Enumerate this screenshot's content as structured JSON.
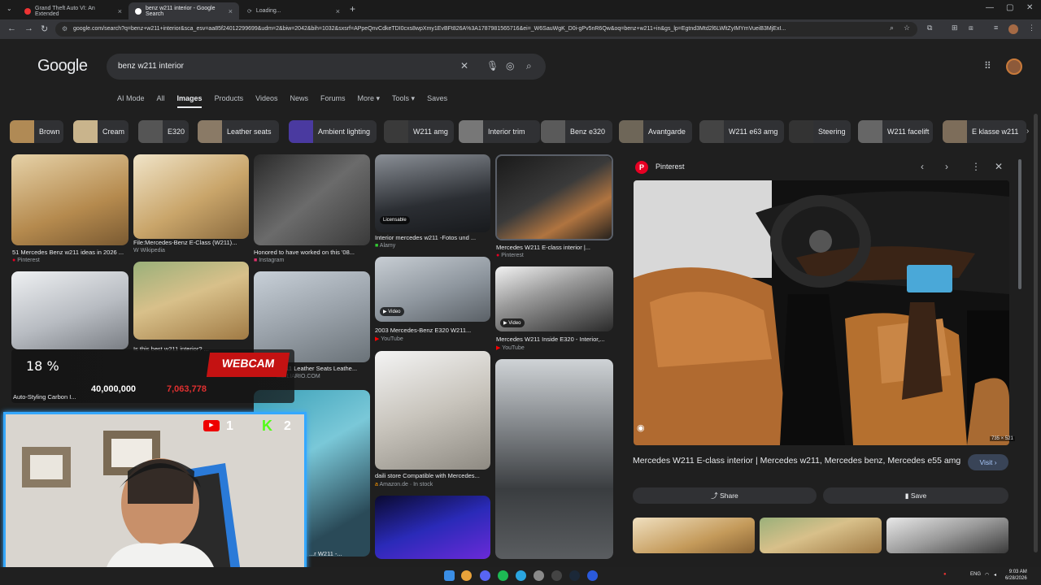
{
  "tabs": [
    {
      "label": "Grand Theft Auto VI: An Extended",
      "active": false
    },
    {
      "label": "benz w211 interior - Google Search",
      "active": true
    },
    {
      "label": "Loading...",
      "active": false
    }
  ],
  "url": "google.com/search?q=benz+w211+interior&sca_esv=aa85f24012299699&udm=2&biw=2042&bih=1032&sxsrf=APpeQnvCdkeTDI0cxs8wpXmy1EvBFt826A%3A1787981565716&ei=_W6SauWgK_D0i-gPv5nR6Qw&oq=benz+w211+in&gs_lp=Egtnd3Mtd2l6LWltZyIMYmVueiB3MjExI...",
  "google": {
    "logo": "Google",
    "query": "benz w211 interior"
  },
  "nav_tabs": [
    "AI Mode",
    "All",
    "Images",
    "Products",
    "Videos",
    "News",
    "Forums",
    "More ▾",
    "Tools ▾",
    "Saves"
  ],
  "chips": [
    "Brown",
    "Cream",
    "E320",
    "Leather seats",
    "Ambient lighting",
    "W211 amg",
    "Interior trim",
    "Benz e320",
    "Avantgarde",
    "W211 e63 amg",
    "Steering",
    "W211 facelift",
    "E klasse w211"
  ],
  "results": [
    {
      "title": "51 Mercedes Benz w211 ideas in 2026 ...",
      "source": "Pinterest"
    },
    {
      "title": "File:Mercedes-Benz E-Class (W211)...",
      "source": "Wikipedia"
    },
    {
      "title": "Honored to have worked on this '08...",
      "source": "Instagram"
    },
    {
      "title": "Interior mercedes w211 -Fotos und ...",
      "source": "Alamy",
      "badge": "Licensable"
    },
    {
      "title": "Mercedes W211 E-class interior |...",
      "source": "Pinterest"
    },
    {
      "title": "Is this best w211 interior? ...",
      "source": ""
    },
    {
      "title": "W211 Leather Seats Leathe...",
      "source": "...BILIARIO.COM"
    },
    {
      "title": "2003 Mercedes-Benz E320 W211...",
      "source": "YouTube",
      "badge": "Video"
    },
    {
      "title": "Mercedes W211 Inside E320 - Interior,...",
      "source": "YouTube",
      "badge": "Video"
    },
    {
      "title": "Auto-Styling Carbon I...",
      "source": ""
    },
    {
      "title": "daili store Compatible with Mercedes...",
      "source": "Amazon.de · In stock"
    },
    {
      "title": "...r W211 -...",
      "source": ""
    }
  ],
  "panel": {
    "site": "Pinterest",
    "title": "Mercedes W211 E-class interior | Mercedes w211, Mercedes benz, Mercedes e55 amg",
    "dims": "735 × 521",
    "visit": "Visit ›",
    "share": "Share",
    "save": "Save"
  },
  "overlay": {
    "percent": "18 %",
    "webcam": "WEBCAM",
    "followers": "40,000,000",
    "subs": "7,063,778",
    "yt_count": "1",
    "kick_count": "2"
  },
  "taskbar": {
    "lang": "ENG",
    "time": "9:03 AM",
    "date": "6/28/2026"
  },
  "colors": {
    "accent": "#a8c7fa",
    "bg": "#1f1f1f",
    "webcam_border": "#35a8ff",
    "webcam_red": "#c41212"
  }
}
